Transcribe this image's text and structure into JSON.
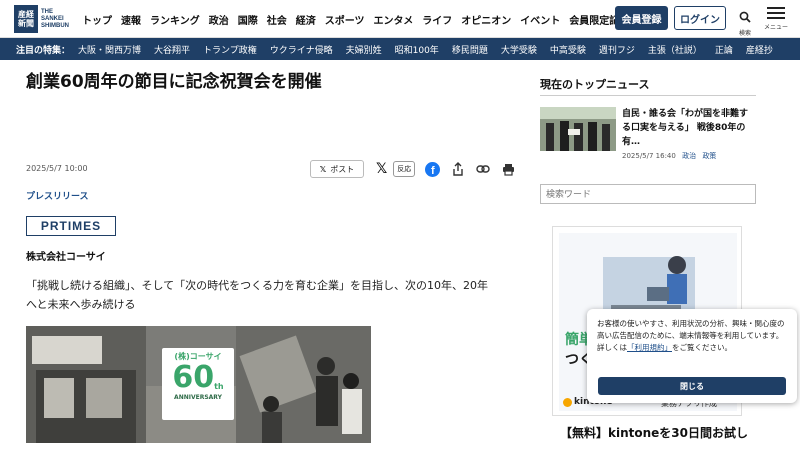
{
  "logo": {
    "kanji": [
      "産",
      "経",
      "新",
      "聞"
    ],
    "en": [
      "THE",
      "SANKEI",
      "SHIMBUN"
    ]
  },
  "nav": [
    "トップ",
    "速報",
    "ランキング",
    "政治",
    "国際",
    "社会",
    "経済",
    "スポーツ",
    "エンタメ",
    "ライフ",
    "オピニオン",
    "イベント",
    "会員限定記事"
  ],
  "header": {
    "member_label": "会員登録",
    "login_label": "ログイン",
    "search_label": "検索",
    "menu_label": "メニュー"
  },
  "topics": {
    "lead": "注目の特集：",
    "items": [
      "大阪・関西万博",
      "大谷翔平",
      "トランプ政権",
      "ウクライナ侵略",
      "夫婦別姓",
      "昭和100年",
      "移民問題",
      "大学受験",
      "中高受験",
      "週刊フジ",
      "主張（社説）",
      "正論",
      "産経抄"
    ]
  },
  "article": {
    "title": "創業60周年の節目に記念祝賀会を開催",
    "date": "2025/5/7 10:00",
    "share": {
      "post_label": "ポスト",
      "react_label": "反応"
    },
    "category": "プレスリリース",
    "source_logo": "PRTIMES",
    "company": "株式会社コーサイ",
    "lead_lines": [
      "「挑戦し続ける組織」、そして「次の時代をつくる力を育む企業」を目指し、次の10年、20年",
      "へと未来へ歩み続ける"
    ],
    "image": {
      "badge_brand": "(株)コーサイ",
      "badge_number": "60",
      "badge_suffix": "th",
      "badge_text": "ANNIVERSARY"
    }
  },
  "sidebar": {
    "heading": "現在のトップニュース",
    "news": {
      "title": "自民・誰る会「わが国を非難する口実を与える」 戦後80年の有…",
      "date": "2025/5/7 16:40",
      "tags": [
        "政治",
        "政策"
      ]
    },
    "search_placeholder": "検索ワード",
    "ad": {
      "headline_1": "簡単",
      "headline_2": "つく",
      "brand": "kintone",
      "brand_right": "業務アプリ作成",
      "title": "【無料】kintoneを30日間お試し"
    }
  },
  "cookie": {
    "text_before": "お客様の使いやすさ、利用状況の分析、興味・関心度の高い広告配信のために、端末情報等を利用しています。詳しくは",
    "link": "「利用規約」",
    "text_after": "をご覧ください。",
    "close_label": "閉じる"
  },
  "colors": {
    "brand_navy": "#1f3f66",
    "link_blue": "#1f4f8a",
    "facebook": "#1877f2"
  }
}
